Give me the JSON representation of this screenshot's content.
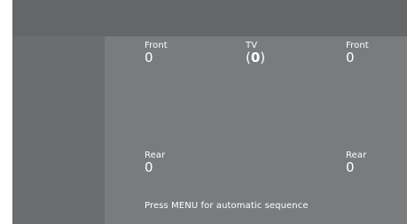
{
  "speakers": {
    "front_left": {
      "label": "Front",
      "value": "0"
    },
    "tv": {
      "label": "TV",
      "value_open": "(",
      "value": "0",
      "value_close": ")"
    },
    "front_right": {
      "label": "Front",
      "value": "0"
    },
    "rear_left": {
      "label": "Rear",
      "value": "0"
    },
    "rear_right": {
      "label": "Rear",
      "value": "0"
    }
  },
  "hint": "Press MENU for automatic sequence",
  "colors": {
    "screen_bg": "#6e7072",
    "top_band": "#646668",
    "panel_bg": "#797b7d",
    "text": "#ffffff"
  }
}
